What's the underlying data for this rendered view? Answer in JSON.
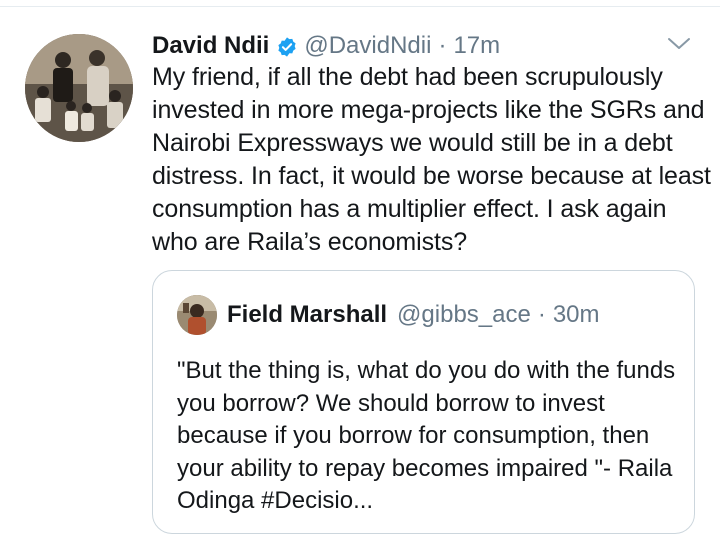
{
  "tweet": {
    "author_name": "David Ndii",
    "author_handle": "@DavidNdii",
    "separator": "·",
    "time": "17m",
    "text": "My friend, if all the debt had been scrupulously invested in more mega-projects like the SGRs and Nairobi Expressways we would still be in a debt distress. In fact, it would be worse because at least consumption has a multiplier effect. I ask again who are Raila’s economists?",
    "verified": true,
    "menu_icon": "chevron-down-icon"
  },
  "quoted_tweet": {
    "author_name": "Field Marshall",
    "author_handle": "@gibbs_ace",
    "separator": "·",
    "time": "30m",
    "text": "\"But the thing is, what do you do with the funds you borrow? We should borrow to invest because if you borrow for consumption, then your ability to repay becomes impaired \"- Raila Odinga #Decisio..."
  },
  "colors": {
    "text": "#14171a",
    "secondary": "#657786",
    "verified_badge": "#1da1f2",
    "border": "#ccd6dd"
  }
}
